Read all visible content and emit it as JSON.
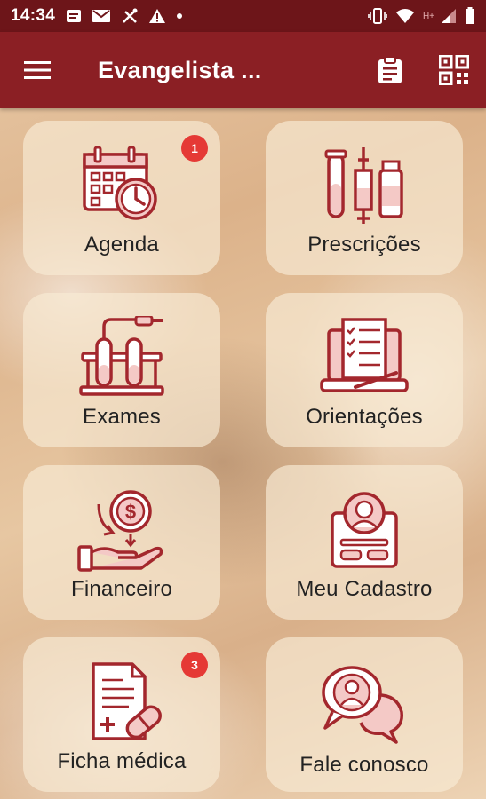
{
  "status": {
    "time": "14:34",
    "left_icons": [
      "notification-box-icon",
      "gmail-icon",
      "tools-icon",
      "warning-icon",
      "dot-icon"
    ],
    "right_icons": [
      "vibrate-icon",
      "wifi-icon",
      "network-hplus-icon",
      "signal-icon",
      "battery-icon"
    ],
    "network_label": "H+"
  },
  "app_bar": {
    "title": "Evangelista ...",
    "color": "#8b1f24"
  },
  "tiles": [
    {
      "label": "Agenda",
      "icon": "calendar-clock-icon",
      "badge": "1"
    },
    {
      "label": "Prescrições",
      "icon": "test-tubes-syringe-icon",
      "badge": null
    },
    {
      "label": "Exames",
      "icon": "lab-rack-icon",
      "badge": null
    },
    {
      "label": "Orientações",
      "icon": "laptop-checklist-icon",
      "badge": null
    },
    {
      "label": "Financeiro",
      "icon": "money-hand-icon",
      "badge": null
    },
    {
      "label": "Meu Cadastro",
      "icon": "id-card-icon",
      "badge": null
    },
    {
      "label": "Ficha médica",
      "icon": "medical-record-icon",
      "badge": "3"
    },
    {
      "label": "Fale conosco",
      "icon": "chat-contact-icon",
      "badge": null
    }
  ],
  "colors": {
    "status_bar": "#6d1519",
    "icon_stroke": "#a3272d",
    "icon_fill": "#f4c9c6",
    "badge": "#e53935"
  }
}
